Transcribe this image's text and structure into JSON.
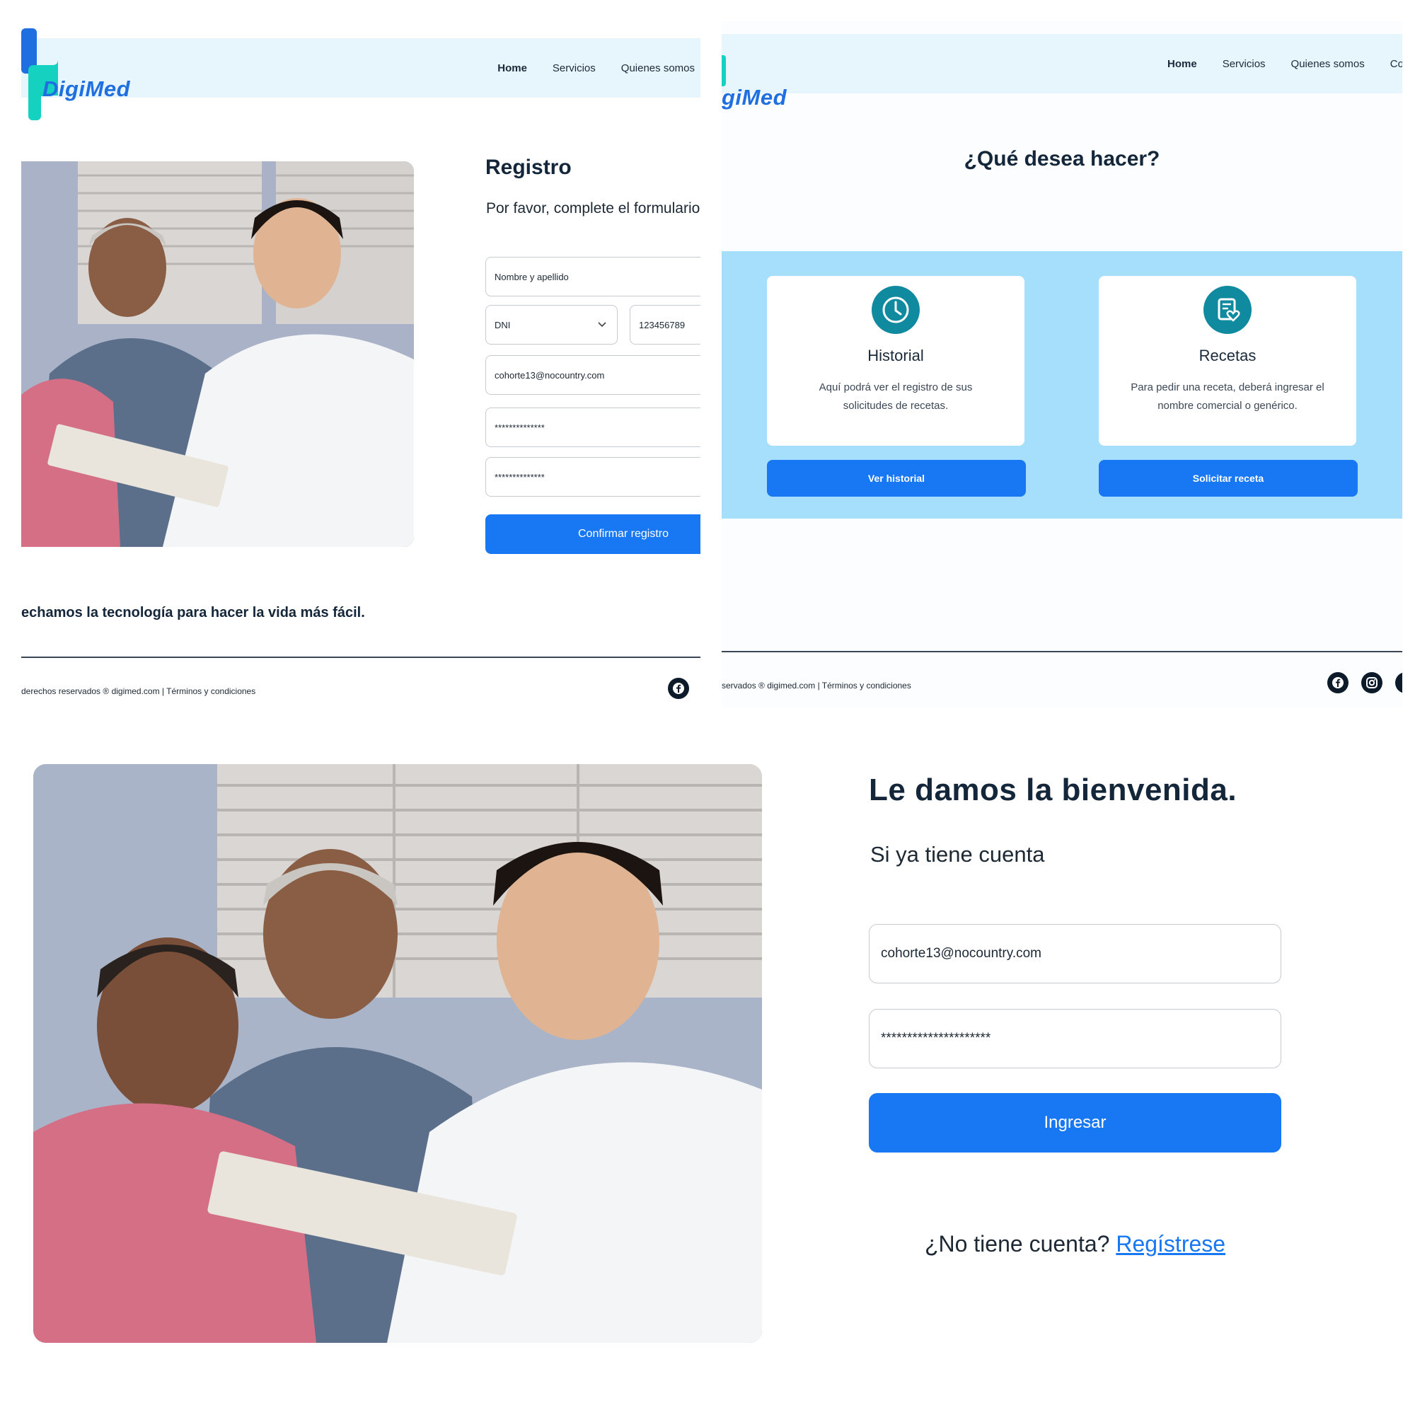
{
  "nav": {
    "home": "Home",
    "servicios": "Servicios",
    "quienes": "Quienes somos",
    "contacto_partial": "Conta"
  },
  "logo": {
    "text": "DigiMed",
    "partial_text": "giMed",
    "colors": {
      "blue": "#1f6fe0",
      "teal": "#14d1c0"
    }
  },
  "registro": {
    "title": "Registro",
    "subtitle": "Por favor, complete el formulario",
    "name_placeholder": "Nombre y apellido",
    "doc_type": "DNI",
    "doc_number": "123456789",
    "email": "cohorte13@nocountry.com",
    "password": "**************",
    "password_confirm": "**************",
    "submit_label": "Confirmar registro",
    "tagline": "echamos la tecnología para hacer la vida más fácil."
  },
  "footer": {
    "left_text_1": "derechos reservados ® digimed.com  | Términos y condiciones",
    "left_text_2": "servados ® digimed.com  | Términos y condiciones"
  },
  "menu": {
    "title": "¿Qué desea hacer?",
    "cards": [
      {
        "icon": "clock-icon",
        "title": "Historial",
        "description": "Aquí podrá ver el registro de sus solicitudes de recetas.",
        "button": "Ver historial"
      },
      {
        "icon": "prescription-heart-icon",
        "title": "Recetas",
        "description": "Para pedir una receta, deberá ingresar el nombre comercial o genérico.",
        "button": "Solicitar receta"
      }
    ]
  },
  "login": {
    "title": "Le damos la bienvenida.",
    "subtitle": "Si ya tiene cuenta",
    "email": "cohorte13@nocountry.com",
    "password": "*********************",
    "submit_label": "Ingresar",
    "no_account": "¿No tiene cuenta?",
    "register_link": "Regístrese"
  },
  "colors": {
    "primary": "#1877f2",
    "navy": "#0c1a2a",
    "header_bg": "#e7f5fd",
    "band_bg": "#a6dffc",
    "icon_teal": "#0f8a9f"
  }
}
